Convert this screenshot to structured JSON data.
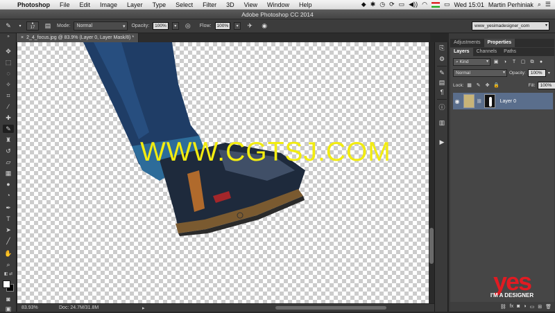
{
  "menubar": {
    "app": "Photoshop",
    "items": [
      "File",
      "Edit",
      "Image",
      "Layer",
      "Type",
      "Select",
      "Filter",
      "3D",
      "View",
      "Window",
      "Help"
    ],
    "clock": "Wed 15:01",
    "user": "Martin Perhiniak"
  },
  "window": {
    "title": "Adobe Photoshop CC 2014"
  },
  "options": {
    "brush_size": "17",
    "mode_label": "Mode:",
    "mode_value": "Normal",
    "opacity_label": "Opacity:",
    "opacity_value": "100%",
    "flow_label": "Flow:",
    "flow_value": "100%",
    "workspace": "www_yesimadesigner_com"
  },
  "document": {
    "tab_title": "2_4_focus.jpg @ 83.9% (Layer 0, Layer Mask/8) *",
    "zoom": "83.93%",
    "doc_size": "Doc: 24.7M/31.8M"
  },
  "panels": {
    "top_tabs": [
      "Adjustments",
      "Properties"
    ],
    "layer_tabs": [
      "Layers",
      "Channels",
      "Paths"
    ],
    "filter_kind": "Kind",
    "blend_mode": "Normal",
    "opacity_label": "Opacity:",
    "opacity_value": "100%",
    "lock_label": "Lock:",
    "fill_label": "Fill:",
    "fill_value": "100%",
    "layers": [
      {
        "name": "Layer 0"
      }
    ],
    "bottom_icons": [
      "go",
      "fx",
      "mask",
      "adjust",
      "folder",
      "new",
      "trash"
    ]
  },
  "watermark": {
    "text": "WWW.CGTSJ.COM"
  },
  "logo": {
    "word": "yes",
    "tagline": "I'M A DESIGNER"
  },
  "colors": {
    "foreground": "#ffffff",
    "background": "#000000",
    "watermark": "#f2ec10",
    "logo_red": "#e01b22"
  }
}
